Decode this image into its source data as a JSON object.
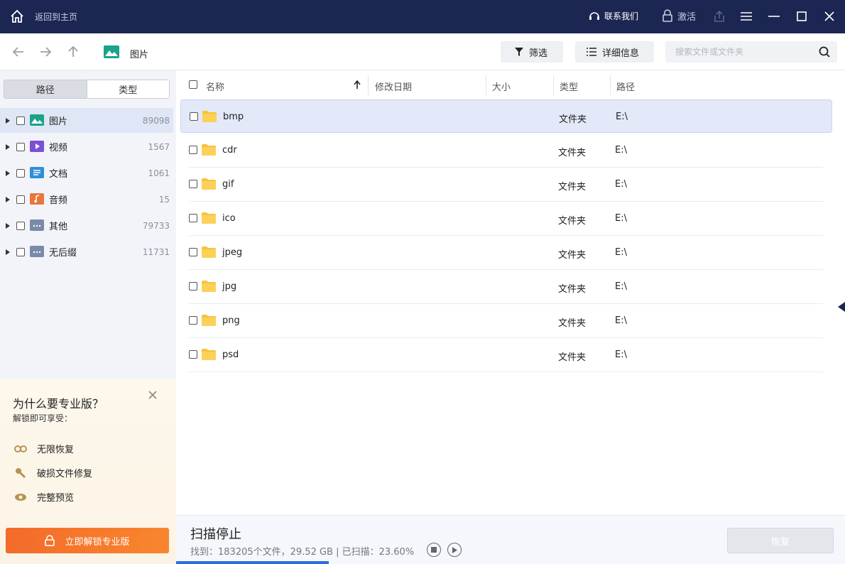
{
  "titlebar": {
    "home_label": "返回到主页",
    "contact_label": "联系我们",
    "activate_label": "激活"
  },
  "navbar": {
    "crumb_label": "图片",
    "filter_label": "筛选",
    "detail_label": "详细信息",
    "search_placeholder": "搜索文件或文件夹"
  },
  "sidebar": {
    "seg_path": "路径",
    "seg_type": "类型",
    "items": [
      {
        "label": "图片",
        "count": "89098",
        "icon": "image-folder-icon",
        "color": "#1aa38a"
      },
      {
        "label": "视频",
        "count": "1567",
        "icon": "video-folder-icon",
        "color": "#7b4fd6"
      },
      {
        "label": "文档",
        "count": "1061",
        "icon": "document-folder-icon",
        "color": "#2f8fd8"
      },
      {
        "label": "音频",
        "count": "15",
        "icon": "audio-folder-icon",
        "color": "#e8763a"
      },
      {
        "label": "其他",
        "count": "79733",
        "icon": "other-folder-icon",
        "color": "#7a8aa8"
      },
      {
        "label": "无后缀",
        "count": "11731",
        "icon": "no-extension-folder-icon",
        "color": "#7a8aa8"
      }
    ]
  },
  "promo": {
    "title": "为什么要专业版？",
    "subtitle": "解锁即可享受：",
    "features": [
      "无限恢复",
      "破损文件修复",
      "完整预览"
    ],
    "unlock_label": "立即解锁专业版"
  },
  "table": {
    "headers": {
      "name": "名称",
      "modified": "修改日期",
      "size": "大小",
      "type": "类型",
      "path": "路径"
    },
    "rows": [
      {
        "name": "bmp",
        "type": "文件夹",
        "path": "E:\\"
      },
      {
        "name": "cdr",
        "type": "文件夹",
        "path": "E:\\"
      },
      {
        "name": "gif",
        "type": "文件夹",
        "path": "E:\\"
      },
      {
        "name": "ico",
        "type": "文件夹",
        "path": "E:\\"
      },
      {
        "name": "jpeg",
        "type": "文件夹",
        "path": "E:\\"
      },
      {
        "name": "jpg",
        "type": "文件夹",
        "path": "E:\\"
      },
      {
        "name": "png",
        "type": "文件夹",
        "path": "E:\\"
      },
      {
        "name": "psd",
        "type": "文件夹",
        "path": "E:\\"
      }
    ]
  },
  "footer": {
    "status_title": "扫描停止",
    "status_info": "找到：183205个文件，29.52 GB | 已扫描：23.60%",
    "scanned_fraction": 0.236,
    "recover_label": "恢复"
  },
  "colors": {
    "titlebar": "#1c2653",
    "accent": "#2b6de0",
    "unlock": "#f46a2a",
    "folder": "#f8c23a"
  }
}
